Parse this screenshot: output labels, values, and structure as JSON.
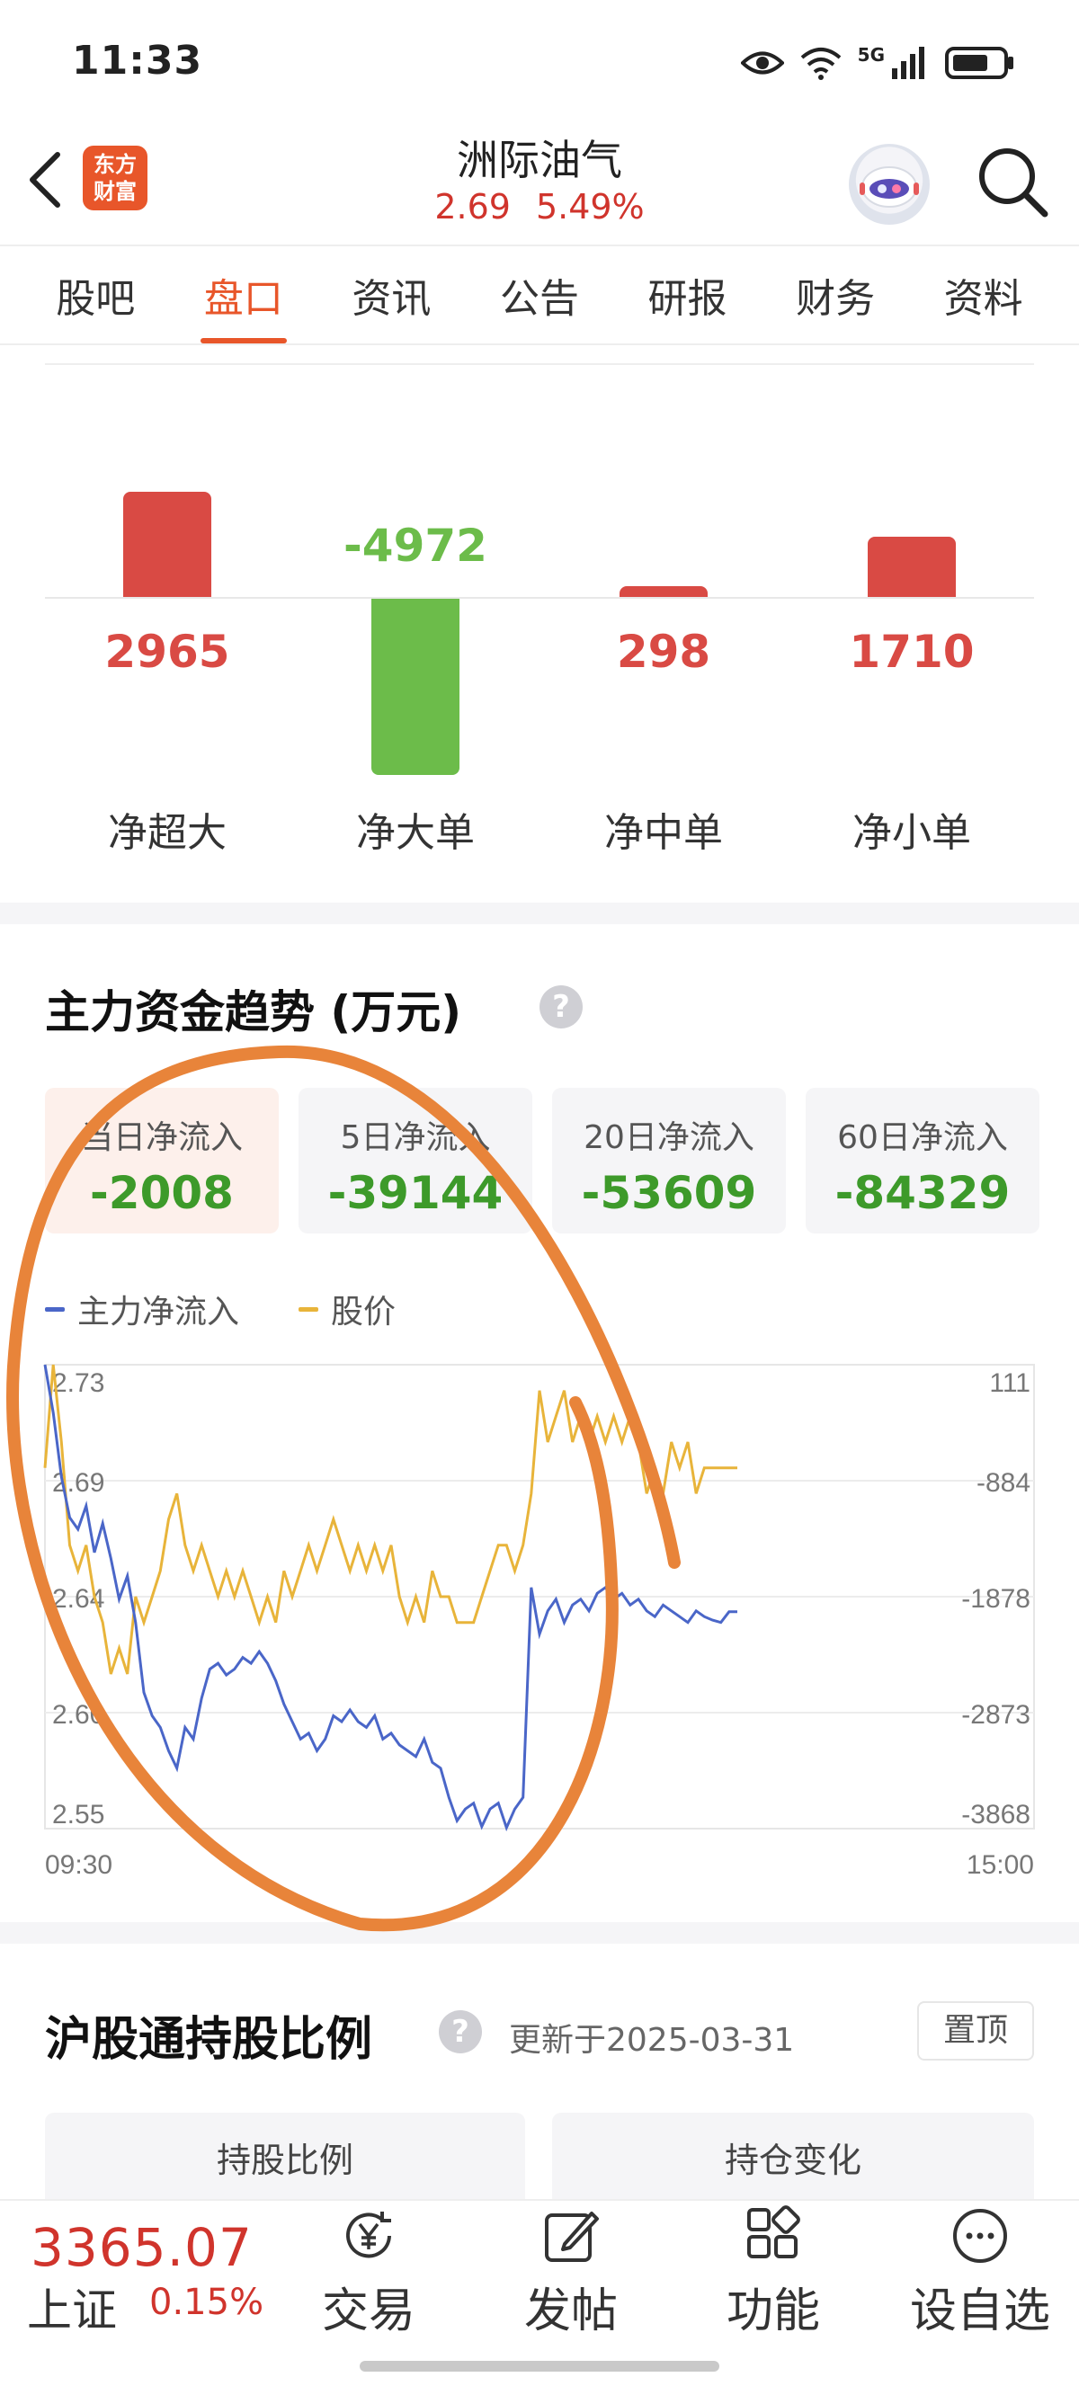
{
  "status_bar": {
    "time": "11:33",
    "network": "5G",
    "icons": [
      "eye-icon",
      "wifi-icon",
      "signal-icon",
      "battery-icon"
    ]
  },
  "header": {
    "logo_text_line1": "东方",
    "logo_text_line2": "财富",
    "stock_name": "洲际油气",
    "price": "2.69",
    "change_pct": "5.49%",
    "icons": [
      "back-icon",
      "robot-avatar-icon",
      "search-icon"
    ]
  },
  "tabs": [
    {
      "label": "股吧"
    },
    {
      "label": "盘口",
      "active": true
    },
    {
      "label": "资讯"
    },
    {
      "label": "公告"
    },
    {
      "label": "研报"
    },
    {
      "label": "财务"
    },
    {
      "label": "资料"
    }
  ],
  "net_flow": {
    "items": [
      {
        "label": "净超大",
        "value": 2965
      },
      {
        "label": "净大单",
        "value": -4972
      },
      {
        "label": "净中单",
        "value": 298
      },
      {
        "label": "净小单",
        "value": 1710
      }
    ],
    "colors": {
      "positive": "#d94a44",
      "negative": "#6cbc4a"
    }
  },
  "trend": {
    "title": "主力资金趋势 (万元)",
    "cards": [
      {
        "label": "当日净流入",
        "value": "-2008",
        "active": true
      },
      {
        "label": "5日净流入",
        "value": "-39144"
      },
      {
        "label": "20日净流入",
        "value": "-53609"
      },
      {
        "label": "60日净流入",
        "value": "-84329"
      }
    ]
  },
  "chart_data": {
    "type": "line",
    "title": "",
    "xlabel": "",
    "x_ticks": [
      "09:30",
      "15:00"
    ],
    "y_left_ticks": [
      "2.73",
      "2.69",
      "2.64",
      "2.60",
      "2.55"
    ],
    "y_left_range": [
      2.55,
      2.73
    ],
    "y_right_ticks": [
      "111",
      "-884",
      "-1878",
      "-2873",
      "-3868"
    ],
    "y_right_range": [
      -3868,
      111
    ],
    "grid": true,
    "legend_position": "top-left",
    "series": [
      {
        "name": "主力净流入",
        "axis": "right",
        "color": "#4a66c8",
        "x": [
          0,
          2,
          4,
          6,
          8,
          10,
          12,
          14,
          16,
          18,
          20,
          22,
          24,
          26,
          28,
          30,
          32,
          34,
          36,
          38,
          40,
          42,
          44,
          46,
          48,
          50,
          52,
          54,
          56,
          58,
          60,
          62,
          64,
          66,
          68,
          70,
          72,
          74,
          76,
          78,
          80,
          82,
          84,
          86,
          88,
          90,
          92,
          94,
          96,
          98,
          100,
          102,
          104,
          106,
          108,
          110,
          112,
          114,
          116,
          118,
          120,
          122,
          124,
          126,
          128,
          130,
          132,
          134,
          136,
          138,
          140,
          142,
          144,
          146,
          148,
          150,
          152,
          154,
          156,
          158,
          160,
          162,
          164,
          166,
          168,
          170,
          172,
          174,
          176,
          178,
          180,
          182,
          184,
          186,
          188,
          190,
          192,
          194,
          196,
          198,
          200,
          202,
          204,
          206,
          208,
          210,
          212,
          214,
          216,
          218,
          220,
          222,
          224,
          226,
          228,
          230,
          232,
          234,
          236,
          238,
          240,
          242,
          244
        ],
        "values": [
          111,
          -300,
          -850,
          -1200,
          -1300,
          -1100,
          -1500,
          -1250,
          -1550,
          -1900,
          -1700,
          -2100,
          -2700,
          -2900,
          -3000,
          -3200,
          -3350,
          -3000,
          -3100,
          -2750,
          -2500,
          -2450,
          -2550,
          -2500,
          -2400,
          -2450,
          -2350,
          -2450,
          -2600,
          -2800,
          -2950,
          -3100,
          -3050,
          -3200,
          -3100,
          -2900,
          -2950,
          -2850,
          -2950,
          -3000,
          -2900,
          -3100,
          -3050,
          -3150,
          -3200,
          -3250,
          -3100,
          -3300,
          -3350,
          -3600,
          -3800,
          -3700,
          -3650,
          -3850,
          -3700,
          -3650,
          -3860,
          -3700,
          -3600,
          -1800,
          -2200,
          -2000,
          -1900,
          -2100,
          -1950,
          -1900,
          -2000,
          -1850,
          -1800,
          -1900,
          -1850,
          -1950,
          -1900,
          -2000,
          -2050,
          -1950,
          -2000,
          -2050,
          -2100,
          -2000,
          -2050,
          -2080,
          -2100,
          -2008,
          -2008,
          -2008,
          -2008,
          -2008,
          -2008,
          -2008,
          -2008,
          -2008,
          -2008,
          -2008,
          -2008,
          -2008,
          -2008,
          -2008,
          -2008,
          -2008,
          -2008,
          -2008,
          -2008,
          -2008,
          -2008,
          -2008,
          -2008,
          -2008,
          -2008,
          -2008,
          -2008,
          -2008,
          -2008,
          -2008,
          -2008,
          -2008,
          -2008,
          -2008,
          -2008,
          -2008,
          -2008,
          -2008,
          -2008
        ]
      },
      {
        "name": "股价",
        "axis": "left",
        "color": "#e8b43a",
        "x": [
          0,
          2,
          4,
          6,
          8,
          10,
          12,
          14,
          16,
          18,
          20,
          22,
          24,
          26,
          28,
          30,
          32,
          34,
          36,
          38,
          40,
          42,
          44,
          46,
          48,
          50,
          52,
          54,
          56,
          58,
          60,
          62,
          64,
          66,
          68,
          70,
          72,
          74,
          76,
          78,
          80,
          82,
          84,
          86,
          88,
          90,
          92,
          94,
          96,
          98,
          100,
          102,
          104,
          106,
          108,
          110,
          112,
          114,
          116,
          118,
          120,
          122,
          124,
          126,
          128,
          130,
          132,
          134,
          136,
          138,
          140,
          142,
          144,
          146,
          148,
          150,
          152,
          154,
          156,
          158,
          160,
          162,
          164,
          166,
          168
        ],
        "values": [
          2.69,
          2.73,
          2.7,
          2.66,
          2.65,
          2.66,
          2.64,
          2.63,
          2.61,
          2.62,
          2.61,
          2.64,
          2.63,
          2.64,
          2.65,
          2.67,
          2.68,
          2.66,
          2.65,
          2.66,
          2.65,
          2.64,
          2.65,
          2.64,
          2.65,
          2.64,
          2.63,
          2.64,
          2.63,
          2.65,
          2.64,
          2.65,
          2.66,
          2.65,
          2.66,
          2.67,
          2.66,
          2.65,
          2.66,
          2.65,
          2.66,
          2.65,
          2.66,
          2.64,
          2.63,
          2.64,
          2.63,
          2.65,
          2.64,
          2.64,
          2.63,
          2.63,
          2.63,
          2.64,
          2.65,
          2.66,
          2.66,
          2.65,
          2.66,
          2.68,
          2.72,
          2.7,
          2.71,
          2.72,
          2.7,
          2.71,
          2.7,
          2.71,
          2.7,
          2.71,
          2.7,
          2.71,
          2.7,
          2.68,
          2.69,
          2.68,
          2.7,
          2.69,
          2.7,
          2.68,
          2.69,
          2.69,
          2.69,
          2.69,
          2.69
        ]
      }
    ]
  },
  "hk_connect": {
    "title": "沪股通持股比例",
    "update": "更新于2025-03-31",
    "pin_label": "置顶",
    "cards": [
      {
        "label": "持股比例"
      },
      {
        "label": "持仓变化"
      }
    ]
  },
  "bottom_bar": {
    "index_value": "3365.07",
    "index_name": "上证",
    "index_pct": "0.15%",
    "nav": [
      {
        "label": "交易",
        "icon": "trade-yen-icon"
      },
      {
        "label": "发帖",
        "icon": "post-edit-icon"
      },
      {
        "label": "功能",
        "icon": "grid-apps-icon"
      },
      {
        "label": "设自选",
        "icon": "more-dots-icon"
      }
    ]
  },
  "annotation": {
    "color": "#e8843a"
  }
}
